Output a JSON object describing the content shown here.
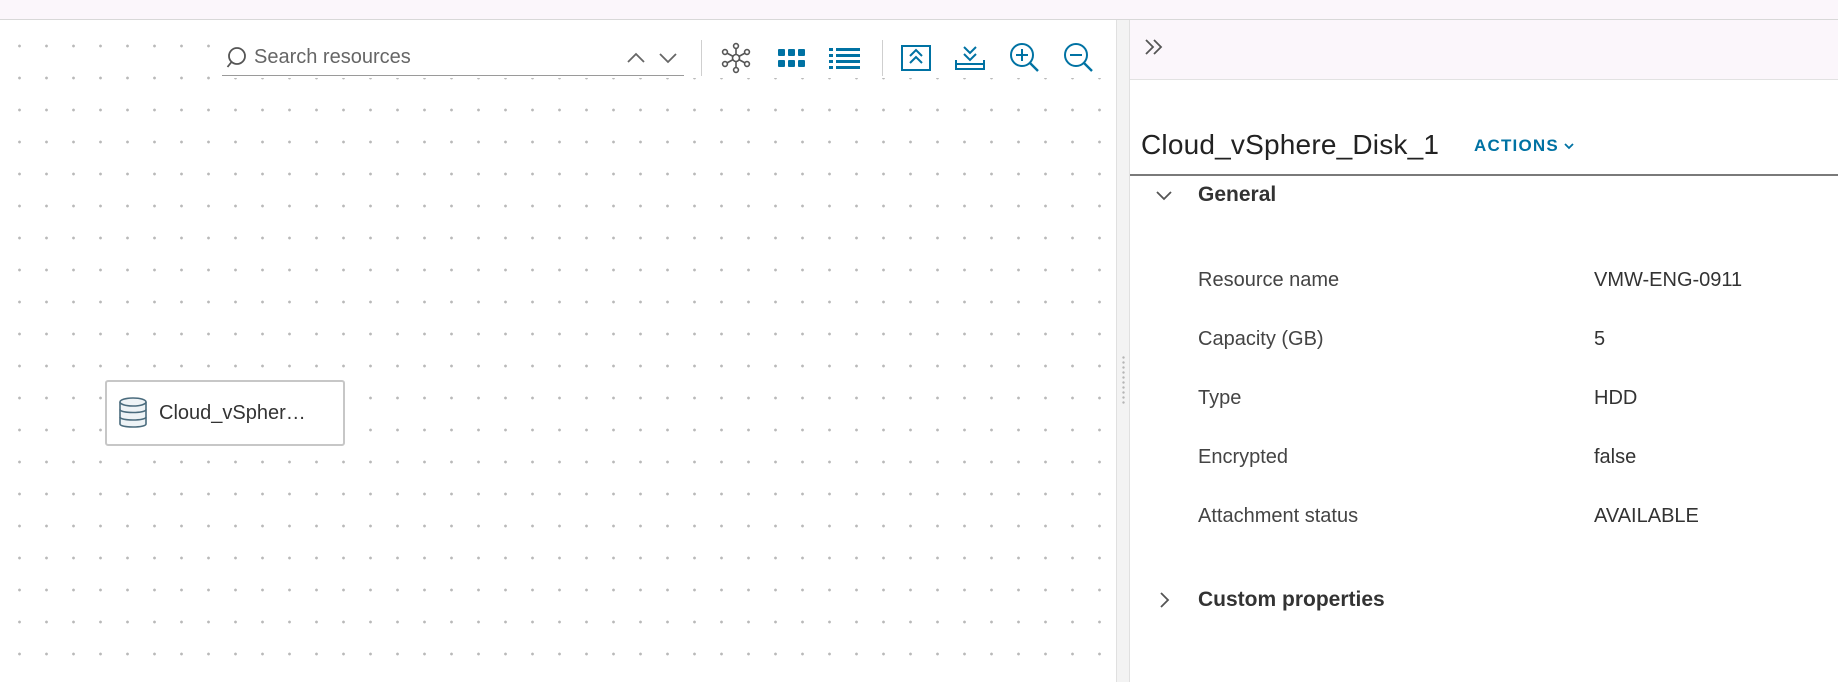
{
  "canvas": {
    "search": {
      "placeholder": "Search resources"
    },
    "toolbar": {
      "icons": [
        "search-icon",
        "chevron-up-icon",
        "chevron-down-icon",
        "topology-view-icon",
        "grid-view-icon",
        "list-view-icon",
        "collapse-all-icon",
        "expand-all-icon",
        "zoom-in-icon",
        "zoom-out-icon"
      ],
      "accent_color": "#0072a3"
    },
    "node": {
      "label": "Cloud_vSpher…",
      "icon": "database-disk-icon"
    }
  },
  "panel": {
    "collapse_icon": "double-chevron-right-icon",
    "title": "Cloud_vSphere_Disk_1",
    "actions_label": "ACTIONS",
    "sections": {
      "general": {
        "label": "General",
        "expanded": true,
        "properties": [
          {
            "key": "Resource name",
            "value": "VMW-ENG-0911"
          },
          {
            "key": "Capacity (GB)",
            "value": "5"
          },
          {
            "key": "Type",
            "value": "HDD"
          },
          {
            "key": "Encrypted",
            "value": "false"
          },
          {
            "key": "Attachment status",
            "value": "AVAILABLE"
          }
        ]
      },
      "custom": {
        "label": "Custom properties",
        "expanded": false
      }
    }
  }
}
